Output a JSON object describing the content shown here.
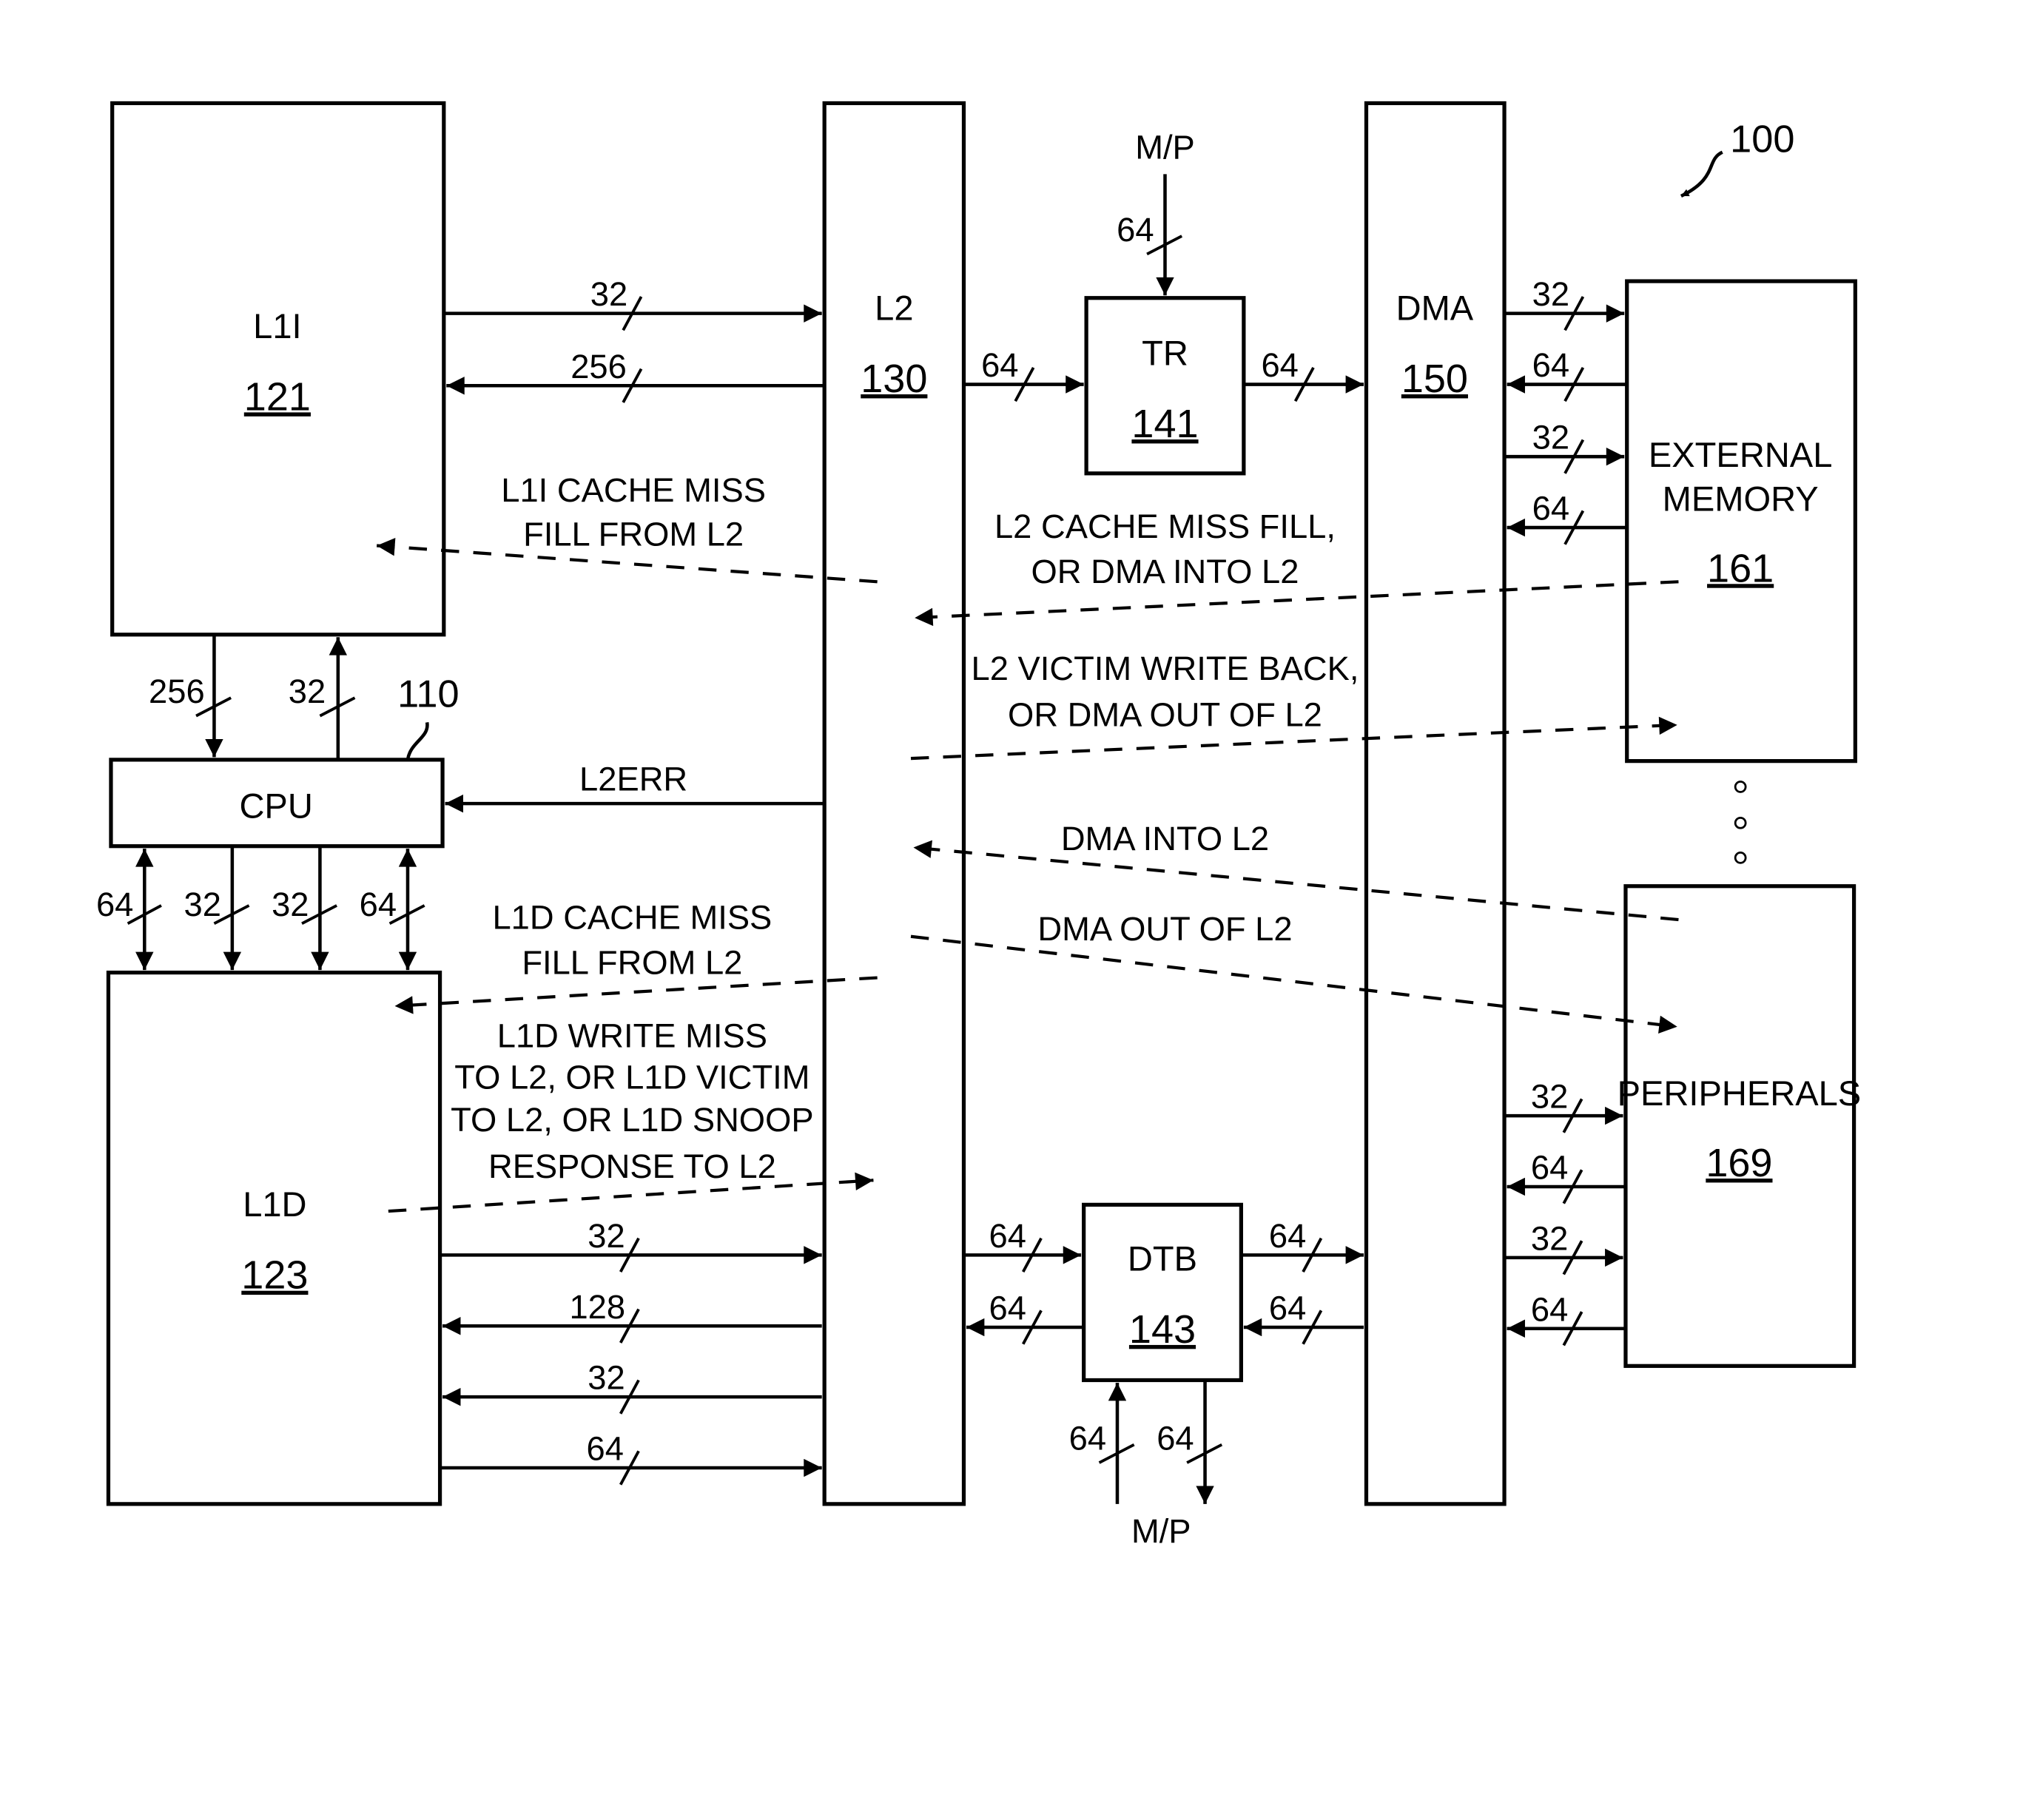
{
  "figure_ref": "100",
  "blocks": {
    "l1i": {
      "name": "L1I",
      "ref": "121"
    },
    "l2": {
      "name": "L2",
      "ref": "130"
    },
    "tr": {
      "name": "TR",
      "ref": "141"
    },
    "dma": {
      "name": "DMA",
      "ref": "150"
    },
    "ext_mem": {
      "name_line1": "EXTERNAL",
      "name_line2": "MEMORY",
      "ref": "161"
    },
    "cpu": {
      "name": "CPU",
      "ref": "110"
    },
    "l1d": {
      "name": "L1D",
      "ref": "123"
    },
    "dtb": {
      "name": "DTB",
      "ref": "143"
    },
    "peripherals": {
      "name": "PERIPHERALS",
      "ref": "169"
    }
  },
  "buses": {
    "l1i_to_l2": "32",
    "l2_to_l1i": "256",
    "l1i_to_cpu": "256",
    "cpu_to_l1i": "32",
    "l2err": "L2ERR",
    "cpu_l1d_1": "64",
    "cpu_l1d_2": "32",
    "cpu_l1d_3": "32",
    "cpu_l1d_4": "64",
    "l1d_to_l2_a": "32",
    "l2_to_l1d_a": "128",
    "l2_to_l1d_b": "32",
    "l1d_to_l2_b": "64",
    "l2_to_tr": "64",
    "tr_to_dma": "64",
    "mp_to_tr": "64",
    "mp_top_label": "M/P",
    "l2_to_dtb": "64",
    "dtb_to_l2": "64",
    "dtb_to_dma": "64",
    "dma_to_dtb": "64",
    "mp_to_dtb": "64",
    "dtb_to_mp": "64",
    "mp_bottom_label": "M/P",
    "dma_to_ext_1": "32",
    "ext_to_dma_1": "64",
    "dma_to_ext_2": "32",
    "ext_to_dma_2": "64",
    "dma_to_per_1": "32",
    "per_to_dma_1": "64",
    "dma_to_per_2": "32",
    "per_to_dma_2": "64"
  },
  "annotations": {
    "l1i_fill": [
      "L1I CACHE MISS",
      "FILL FROM L2"
    ],
    "l2_fill": [
      "L2 CACHE MISS FILL,",
      "OR DMA INTO L2"
    ],
    "l2_victim": [
      "L2 VICTIM WRITE BACK,",
      "OR DMA OUT OF L2"
    ],
    "dma_into": [
      "DMA INTO L2"
    ],
    "dma_out": [
      "DMA OUT OF L2"
    ],
    "l1d_fill": [
      "L1D CACHE MISS",
      "FILL FROM L2"
    ],
    "l1d_write": [
      "L1D WRITE MISS",
      "TO L2, OR L1D VICTIM",
      "TO L2, OR L1D SNOOP",
      "RESPONSE TO L2"
    ]
  }
}
